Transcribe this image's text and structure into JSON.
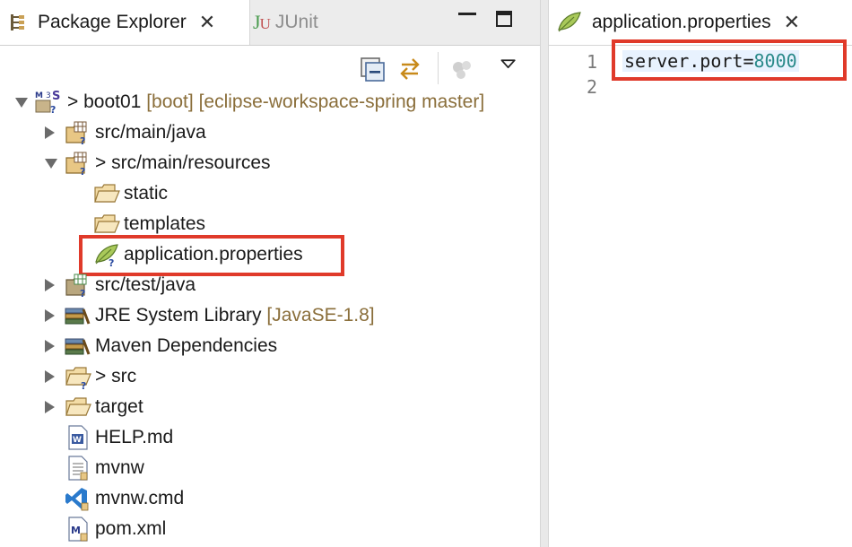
{
  "left_tabs": {
    "package_explorer": "Package Explorer",
    "package_explorer_close": "✕",
    "junit_icon_j": "J",
    "junit_icon_u": "U",
    "junit": "JUnit"
  },
  "tree": {
    "project": {
      "prefix": ">",
      "name": "boot01",
      "decoration": "[boot] [eclipse-workspace-spring master]"
    },
    "src_main_java": {
      "name": "src/main/java"
    },
    "src_main_resources": {
      "prefix": ">",
      "name": "src/main/resources"
    },
    "static": {
      "name": "static"
    },
    "templates": {
      "name": "templates"
    },
    "application_properties": {
      "name": "application.properties"
    },
    "src_test_java": {
      "name": "src/test/java"
    },
    "jre": {
      "name": "JRE System Library",
      "decoration": "[JavaSE-1.8]"
    },
    "maven": {
      "name": "Maven Dependencies"
    },
    "src": {
      "prefix": ">",
      "name": "src"
    },
    "target": {
      "name": "target"
    },
    "help": {
      "name": "HELP.md"
    },
    "mvnw": {
      "name": "mvnw"
    },
    "mvnw_cmd": {
      "name": "mvnw.cmd"
    },
    "pom": {
      "name": "pom.xml"
    }
  },
  "editor": {
    "tab_title": "application.properties",
    "tab_close": "✕",
    "line_numbers": [
      "1",
      "2"
    ],
    "line1_key": "server.port=",
    "line1_value": "8000"
  },
  "colors": {
    "highlight_box": "#e03a2a",
    "property_value": "#2a8a8a",
    "decoration_text": "#8a6e3a"
  },
  "icons": {
    "package_explorer_tab": "package-explorer-icon",
    "collapse_all": "collapse-all-icon",
    "link_with_editor": "link-with-editor-icon",
    "focus": "focus-icon",
    "view_menu": "view-menu-icon",
    "properties_file": "leaf-icon"
  }
}
